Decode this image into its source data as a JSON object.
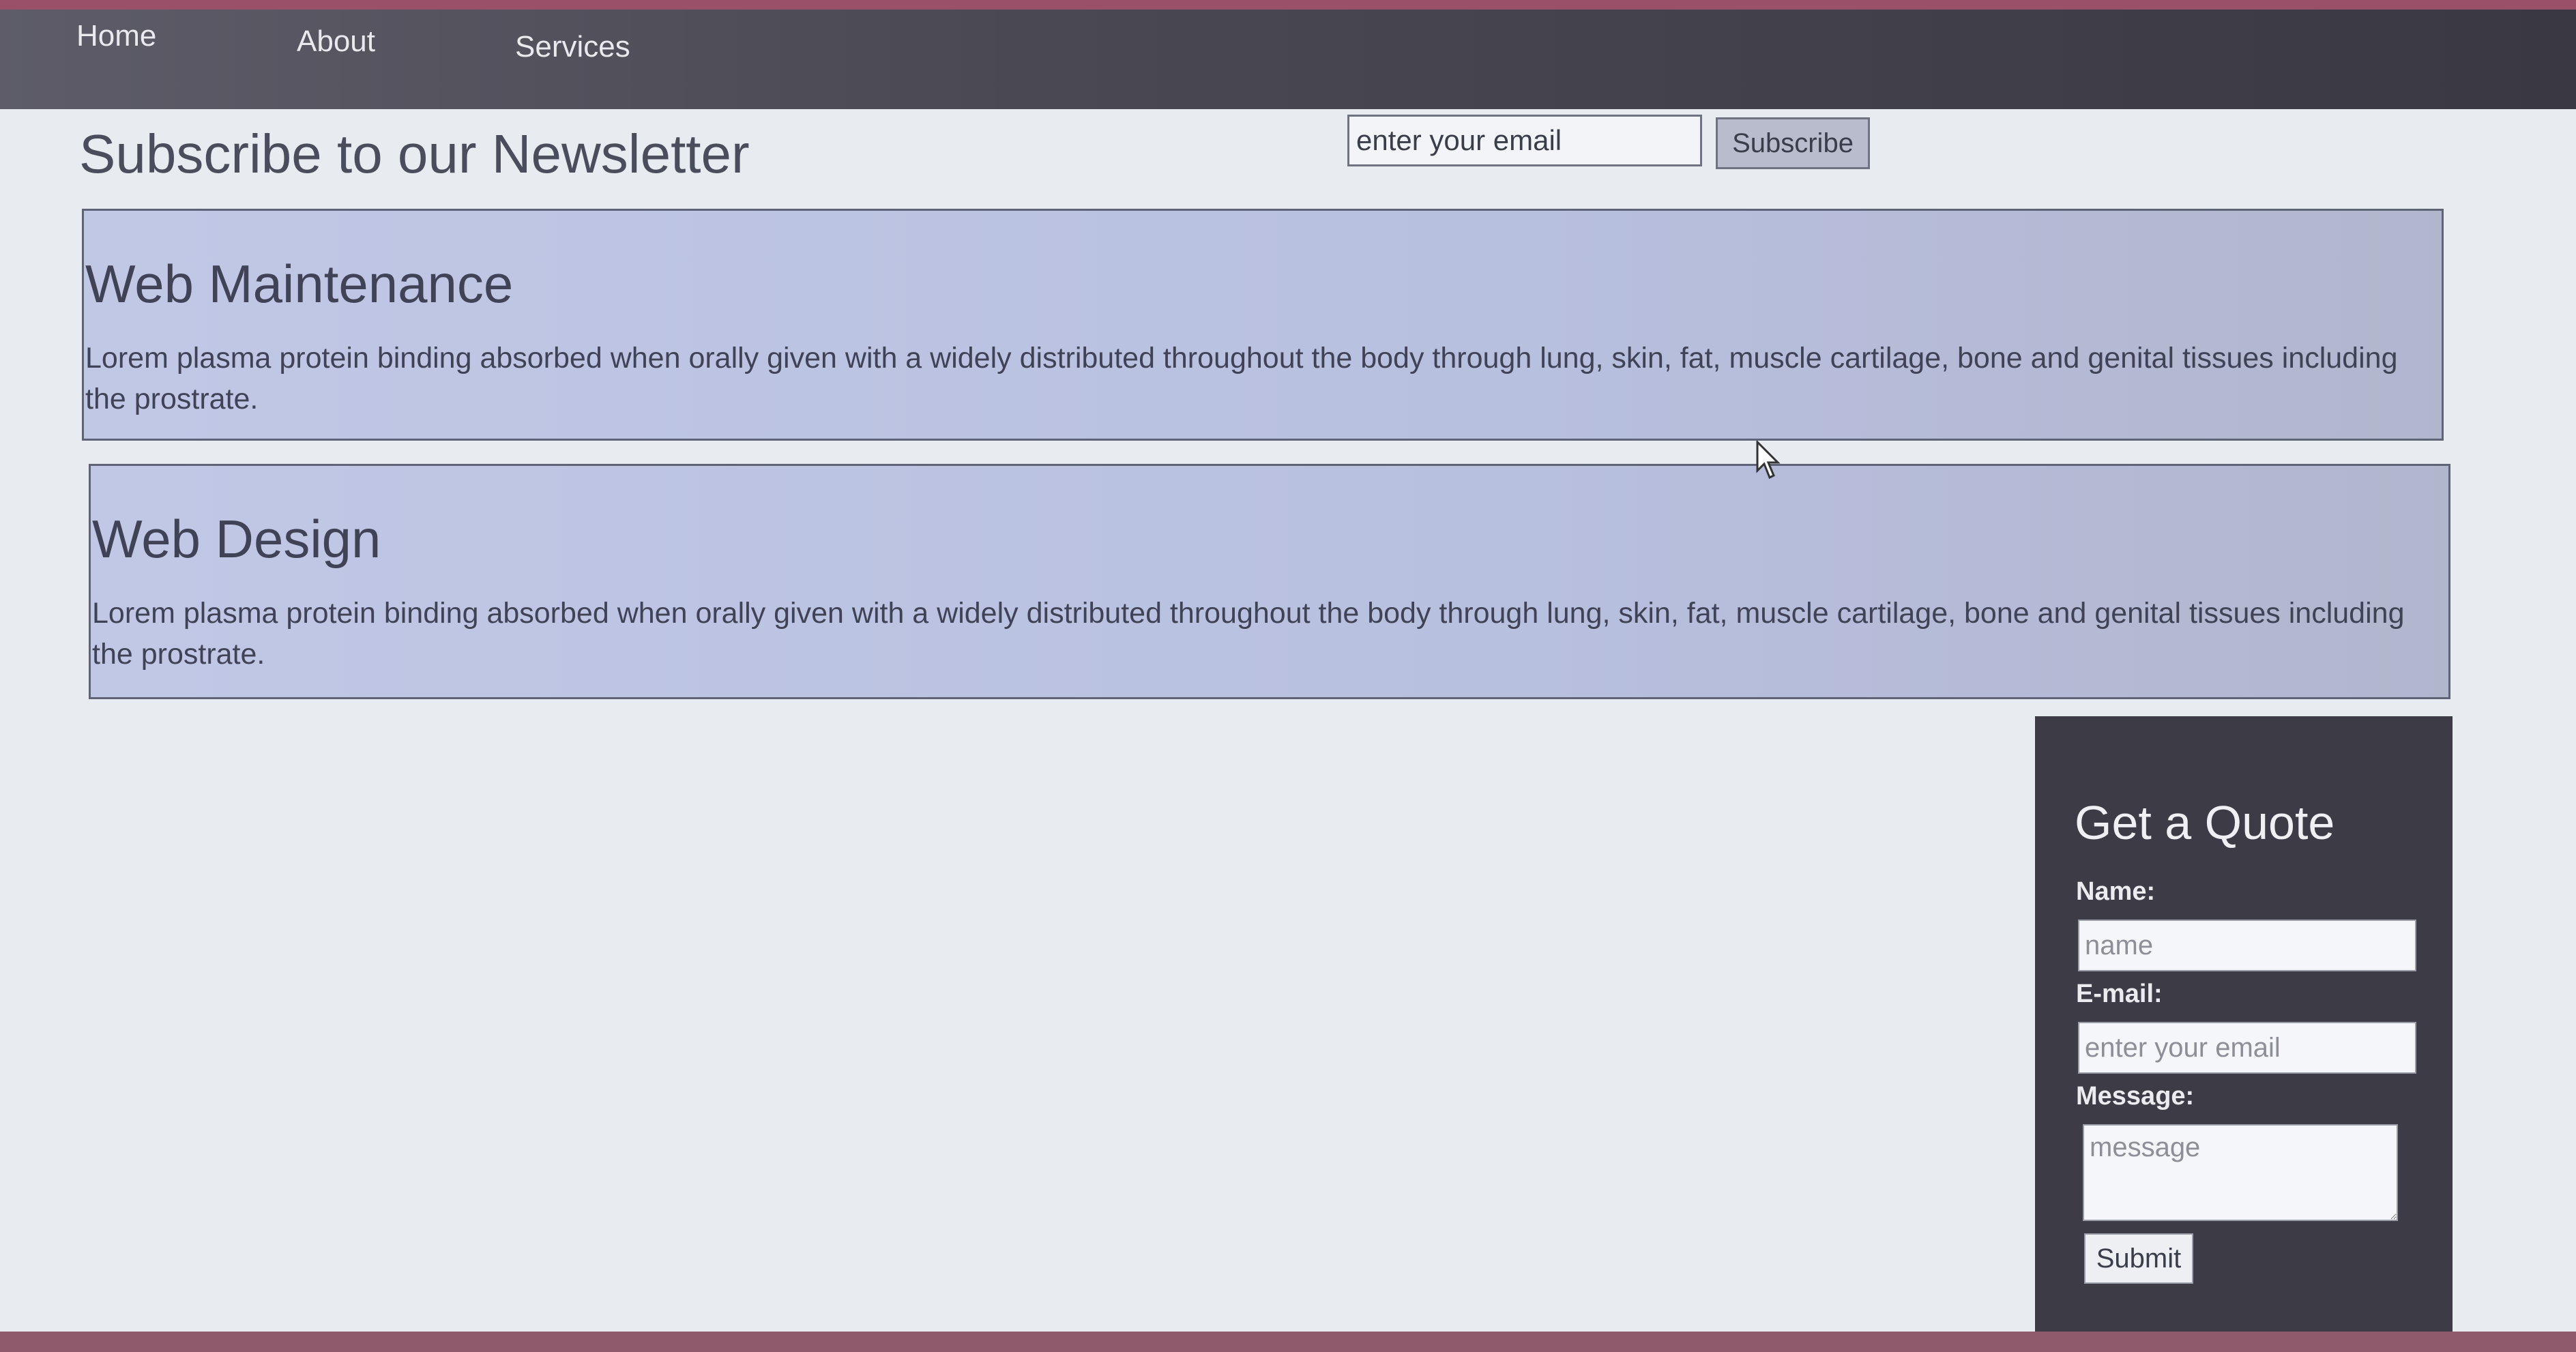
{
  "nav": {
    "items": [
      {
        "label": "Home"
      },
      {
        "label": "About"
      },
      {
        "label": "Services"
      }
    ]
  },
  "newsletter": {
    "title": "Subscribe to our Newsletter",
    "email_placeholder": "enter your email",
    "subscribe_label": "Subscribe"
  },
  "services": [
    {
      "title": "Web Maintenance",
      "description": "Lorem plasma protein binding absorbed when orally given with a widely distributed throughout the body through lung, skin, fat, muscle cartilage, bone and genital tissues including the prostrate."
    },
    {
      "title": "Web Design",
      "description": "Lorem plasma protein binding absorbed when orally given with a widely distributed throughout the body through lung, skin, fat, muscle cartilage, bone and genital tissues including the prostrate."
    }
  ],
  "quote": {
    "title": "Get a Quote",
    "name_label": "Name:",
    "name_placeholder": "name",
    "email_label": "E-mail:",
    "email_placeholder": "enter your email",
    "message_label": "Message:",
    "message_placeholder": "message",
    "submit_label": "Submit"
  },
  "colors": {
    "nav_bg": "#4a4852",
    "service_box_bg": "#bcc4e4",
    "quote_panel_bg": "#3d3c46"
  }
}
